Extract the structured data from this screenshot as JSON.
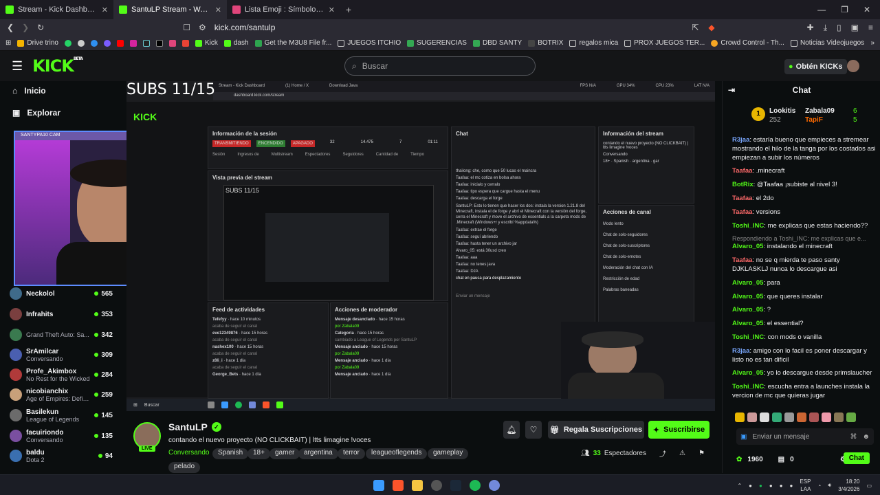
{
  "browser": {
    "tabs": [
      {
        "label": "Stream - Kick Dashboard",
        "color": "#53fc18",
        "active": false
      },
      {
        "label": "SantuLP Stream - Watch Live",
        "color": "#53fc18",
        "active": true
      },
      {
        "label": "Lista Emoji : Símbolos emoji nativas",
        "color": "#e0457b",
        "active": false
      }
    ],
    "url": "kick.com/santulp",
    "bookmarks": [
      "Drive trino",
      "",
      "",
      "",
      "",
      "",
      "",
      "",
      "",
      "",
      "",
      "Kick",
      "dash",
      "Get the M3U8 File fr...",
      "JUEGOS ITCHIO",
      "SUGERENCIAS",
      "DBD SANTY",
      "BOTRIX",
      "regalos mica",
      "PROX JUEGOS TER...",
      "Crowd Control - Th...",
      "Noticias Videojuegos"
    ]
  },
  "header": {
    "logo": "KICK",
    "beta": "BETA",
    "search_placeholder": "Buscar",
    "kicks_label": "Obtén KICKs"
  },
  "sidebar": {
    "nav": [
      {
        "label": "Inicio",
        "icon": "home-icon"
      },
      {
        "label": "Explorar",
        "icon": "compass-icon"
      }
    ],
    "overlay_channels": [
      {
        "name": "Neckolol",
        "viewers": "565"
      },
      {
        "name": "Infrahits",
        "viewers": "353"
      },
      {
        "name": "",
        "viewers": "342",
        "game": "Grand Theft Auto: Sa..."
      }
    ],
    "channels": [
      {
        "name": "SrAmilcar",
        "game": "Conversando",
        "viewers": "309",
        "color": "#4a5fb0"
      },
      {
        "name": "Profe_Akimbox",
        "game": "No Rest for the Wicked",
        "viewers": "284",
        "color": "#b03a3a"
      },
      {
        "name": "nicobianchix",
        "game": "Age of Empires: Defin...",
        "viewers": "259",
        "color": "#c8a07a"
      },
      {
        "name": "Basilekun",
        "game": "League of Legends",
        "viewers": "145",
        "color": "#6b6b6b"
      },
      {
        "name": "facuiriondo",
        "game": "Conversando",
        "viewers": "135",
        "color": "#7a4fa0"
      },
      {
        "name": "baldu",
        "game": "Dota 2",
        "viewers": "94",
        "color": "#3a6fb0"
      }
    ]
  },
  "stream_overlay": {
    "subs_text": "SUBS 11/15",
    "cam_label": "SANTYPA10 CAM",
    "dash_url": "dashboard.kick.com/stream",
    "session_title": "Información de la sesión",
    "session_stats": [
      "TRANSMITIENDO",
      "ENCENDIDO",
      "APAGADO",
      "32",
      "14.475",
      "7",
      "01:11"
    ],
    "session_labels": [
      "Sesión",
      "Ingresos de",
      "Multistream",
      "Espectadores",
      "Seguidores",
      "Cantidad de",
      "Tiempo"
    ],
    "preview_title": "Vista previa del stream",
    "chat_title": "Chat",
    "stream_info_title": "Información del stream",
    "stream_info_text": "contando el nuevo proyecto (NO CLICKBAIT) | ltts limagine !voces",
    "stream_info_cat": "Conversando",
    "stream_info_tags": [
      "18+",
      "Spanish",
      "argentina",
      "gar"
    ],
    "actions_title": "Acciones de canal",
    "actions": [
      "Modo lento",
      "Chat de solo-seguidores",
      "Chat de solo-suscriptores",
      "Chat de solo-emotes",
      "Moderación del chat con IA",
      "Restricción de edad",
      "Palabras baneadas"
    ],
    "feed_title": "Feed de actividades",
    "feed": [
      {
        "name": "Tefefyy",
        "desc": "acaba de seguir el canal",
        "time": "hace 10 minutos"
      },
      {
        "name": "eve12349876",
        "desc": "acaba de seguir el canal",
        "time": "hace 15 horas"
      },
      {
        "name": "nashex100",
        "desc": "acaba de seguir el canal",
        "time": "hace 15 horas"
      },
      {
        "name": "z8li_i",
        "desc": "acaba de seguir el canal",
        "time": "hace 1 día"
      },
      {
        "name": "George_Bets",
        "desc": "",
        "time": "hace 1 día"
      }
    ],
    "mod_title": "Acciones de moderador",
    "mod": [
      {
        "name": "Mensaje desanclado",
        "desc": "por Zabala09",
        "time": "hace 15 horas"
      },
      {
        "name": "Categoría",
        "desc": "cambiado a League of Legends por SantuLP",
        "time": "hace 15 horas"
      },
      {
        "name": "Mensaje anclado",
        "desc": "por Zabala09",
        "time": "hace 15 horas"
      },
      {
        "name": "Mensaje anclado",
        "desc": "por Zabala09",
        "time": "hace 1 día"
      },
      {
        "name": "Mensaje anclado",
        "desc": "",
        "time": "hace 1 día"
      }
    ],
    "chat_lines": [
      "thailong: che, como que 50 lucas el maincra",
      "Taafaa: el mc cotiza en bolsa ahora",
      "Taafaa: inicialo y cerralo",
      "Taafaa: tipo espera que cargue hasta el menu",
      "Taafaa: descarga el forge",
      "SantuLP: Esto lo tienen que hacer los dos: instala la version 1.21.8 del Minecraft, instala el de forge y abrí el Minecraft con la versión del forge, cerra el Minecraft y move el archivo de essentials a la carpeta mods de .Minecraft (Windows+r y escribí %appdata%)",
      "Taafaa: extrae el forge",
      "Taafaa: seguí abriendo",
      "Taafaa: hasta tener un archivo jar",
      "Alvaro_05: está 30usd creo",
      "Taafaa: aaa",
      "Taafaa: no tenes java",
      "Taafaa: DJA"
    ],
    "chat_paused": "chat en pausa para desplazamiento",
    "send_placeholder": "Enviar un mensaje",
    "mini_search": "Buscar",
    "mini_stats": [
      "FPS N/A",
      "GPU 34%",
      "CPU 23%",
      "LAT N/A"
    ]
  },
  "stream_info": {
    "name": "SantuLP",
    "live": "LIVE",
    "title": "contando el nuevo proyecto (NO CLICKBAIT) | ltts limagine !voces",
    "category": "Conversando",
    "tags": [
      "Spanish",
      "18+",
      "gamer",
      "argentina",
      "terror",
      "leagueoflegends",
      "gameplay",
      "pelado"
    ],
    "gift_label": "Regala Suscripciones",
    "subscribe_label": "Suscribirse",
    "viewers": "33",
    "viewers_label": "Espectadores"
  },
  "chat": {
    "title": "Chat",
    "pinned": [
      {
        "name": "Lookitis",
        "count": "252",
        "rank": "1"
      },
      {
        "name": "Zabala09",
        "count": "6"
      },
      {
        "name": "TapiF",
        "count": "5"
      }
    ],
    "messages": [
      {
        "user": "R3jaa",
        "color": "#7aa8ff",
        "text": "estaría bueno que empieces a stremear mostrando el hilo de la tanga por los costados asi empiezan a subir los números"
      },
      {
        "user": "Taafaa",
        "color": "#ff6a6a",
        "text": ".minecraft"
      },
      {
        "user": "BotRix",
        "color": "#53fc18",
        "text": "@Taafaa ¡subiste al nivel 3!"
      },
      {
        "user": "Taafaa",
        "color": "#ff6a6a",
        "text": "el 2do"
      },
      {
        "user": "Taafaa",
        "color": "#ff6a6a",
        "text": "versions"
      },
      {
        "user": "Toshi_INC",
        "color": "#53fc18",
        "text": "me explicas que estas haciendo??"
      },
      {
        "reply": "Respondiendo a Toshi_INC: me explicas que e...",
        "user": "Alvaro_05",
        "color": "#53fc18",
        "text": "instalando el minecraft"
      },
      {
        "user": "Taafaa",
        "color": "#ff6a6a",
        "text": "no se q mierda te paso santy DJKLASKLJ nunca lo descargue asi"
      },
      {
        "user": "Alvaro_05",
        "color": "#53fc18",
        "text": "para"
      },
      {
        "user": "Alvaro_05",
        "color": "#53fc18",
        "text": "que queres instalar"
      },
      {
        "user": "Alvaro_05",
        "color": "#53fc18",
        "text": "?"
      },
      {
        "user": "Alvaro_05",
        "color": "#53fc18",
        "text": "el essential?"
      },
      {
        "user": "Toshi_INC",
        "color": "#53fc18",
        "text": "con mods o vanilla"
      },
      {
        "user": "R3jaa",
        "color": "#7aa8ff",
        "text": "amigo con lo facil es poner descargar y listo no es tan dificil"
      },
      {
        "user": "Alvaro_05",
        "color": "#53fc18",
        "text": "yo lo descargue desde primslaucher"
      },
      {
        "user": "Toshi_INC",
        "color": "#53fc18",
        "text": "escucha entra a launches instala la vercion de mc que quieras jugar"
      }
    ],
    "input_placeholder": "Enviar un mensaje",
    "points": "1960",
    "redeems": "0",
    "chat_button": "Chat"
  },
  "taskbar": {
    "lang": "ESP",
    "lang2": "LAA",
    "time": "18:20",
    "date": "3/4/2026"
  }
}
